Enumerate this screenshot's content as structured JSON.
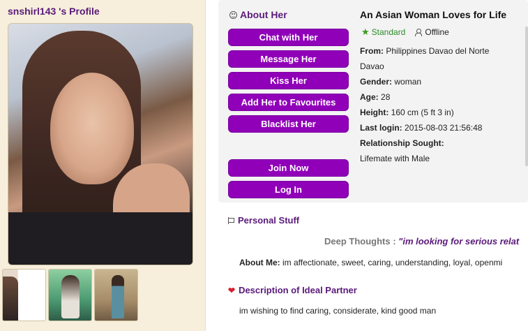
{
  "profile": {
    "title": "snshirl143 's Profile",
    "main_photo_alt": "profile photo",
    "thumbnails": [
      "photo 1",
      "photo 2",
      "photo 3"
    ]
  },
  "about": {
    "heading": "About Her",
    "buttons": {
      "chat": "Chat with Her",
      "message": "Message Her",
      "kiss": "Kiss Her",
      "favourites": "Add Her to Favourites",
      "blacklist": "Blacklist Her",
      "join": "Join Now",
      "login": "Log In"
    }
  },
  "info": {
    "headline": "An Asian Woman Loves for Life",
    "membership": "Standard",
    "online_status": "Offline",
    "from_label": "From:",
    "from_value": "Philippines Davao del Norte",
    "from_value2": "Davao",
    "gender_label": "Gender:",
    "gender_value": "woman",
    "age_label": "Age:",
    "age_value": "28",
    "height_label": "Height:",
    "height_value": "160 cm (5 ft 3 in)",
    "last_login_label": "Last login:",
    "last_login_value": "2015-08-03 21:56:48",
    "relationship_label": "Relationship Sought:",
    "relationship_value": "Lifemate with Male"
  },
  "personal": {
    "heading": "Personal Stuff",
    "deep_thoughts_label": "Deep Thoughts :",
    "deep_thoughts_value": "\"im looking for serious relat",
    "about_me_label": "About Me:",
    "about_me_value": "im affectionate, sweet, caring, understanding, loyal, openmi"
  },
  "ideal_partner": {
    "heading": "Description of Ideal Partner",
    "text": "im wishing to find caring, considerate, kind good man"
  },
  "colors": {
    "accent_purple": "#9000b8",
    "heading_purple": "#5a1a7a",
    "panel_beige": "#f7efdc",
    "standard_green": "#2a8a2a"
  }
}
